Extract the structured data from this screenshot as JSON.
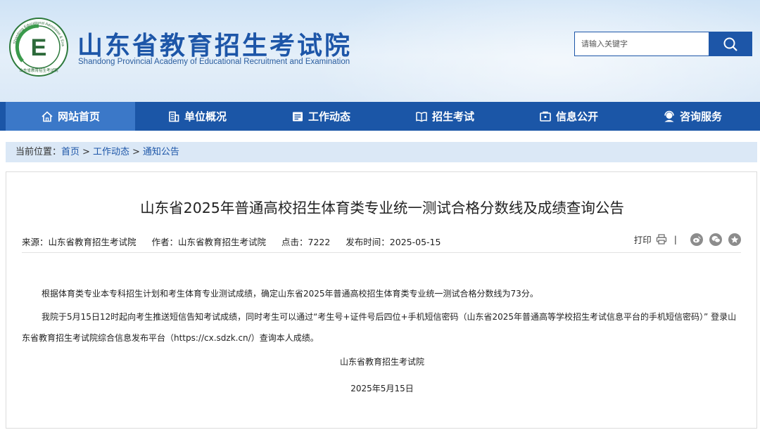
{
  "header": {
    "site_title_cn": "山东省教育招生考试院",
    "site_title_en": "Shandong Provincial Academy of Educational Recruitment and Examination",
    "logo_ring_text": "Shandong Educational Admission & Examination",
    "logo_bottom_text": "山东省教育招生考试院",
    "logo_letter": "E",
    "search_placeholder": "请输入关键字"
  },
  "nav": {
    "items": [
      {
        "label": "网站首页",
        "icon": "home-icon"
      },
      {
        "label": "单位概况",
        "icon": "building-icon"
      },
      {
        "label": "工作动态",
        "icon": "list-icon"
      },
      {
        "label": "招生考试",
        "icon": "book-icon"
      },
      {
        "label": "信息公开",
        "icon": "info-icon"
      },
      {
        "label": "咨询服务",
        "icon": "headset-icon"
      }
    ]
  },
  "breadcrumb": {
    "prefix": "当前位置：",
    "items": [
      "首页",
      "工作动态",
      "通知公告"
    ],
    "sep": ">"
  },
  "article": {
    "title": "山东省2025年普通高校招生体育类专业统一测试合格分数线及成绩查询公告",
    "meta": {
      "source": "来源：山东省教育招生考试院",
      "author": "作者：山东省教育招生考试院",
      "clicks": "点击：7222",
      "published": "发布时间：2025-05-15"
    },
    "share": {
      "print_label": "打印",
      "divider": "|"
    },
    "paragraphs": [
      "根据体育类专业本专科招生计划和考生体育专业测试成绩，确定山东省2025年普通高校招生体育类专业统一测试合格分数线为73分。",
      "我院于5月15日12时起向考生推送短信告知考试成绩，同时考生可以通过“考生号+证件号后四位+手机短信密码（山东省2025年普通高等学校招生考试信息平台的手机短信密码）” 登录山东省教育招生考试院综合信息发布平台（https://cx.sdzk.cn/）查询本人成绩。"
    ],
    "signature": "山东省教育招生考试院",
    "date": "2025年5月15日"
  },
  "colors": {
    "brand_blue": "#1b56a7",
    "nav_active": "#3b78c8",
    "breadcrumb_bg": "#dbe8f6"
  }
}
